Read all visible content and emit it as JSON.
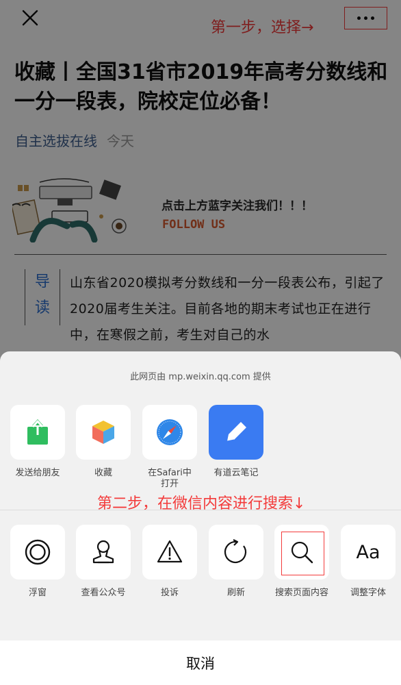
{
  "topbar": {
    "close_icon": "close-icon",
    "step1_annotation": "第一步，选择→",
    "more_icon": "more-dots-icon"
  },
  "article": {
    "title": "收藏丨全国31省市2019年高考分数线和一分一段表，院校定位必备！",
    "account_name": "自主选拔在线",
    "date": "今天",
    "banner_text": "点击上方蓝字关注我们！！！",
    "banner_follow": "FOLLOW US",
    "guide_label_1": "导",
    "guide_label_2": "读",
    "guide_text": "山东省2020模拟考分数线和一分一段表公布，引起了2020届考生关注。目前各地的期末考试也正在进行中，在寒假之前，考生对自己的水"
  },
  "sheet": {
    "provider": "此网页由 mp.weixin.qq.com 提供",
    "row1": [
      {
        "label": "发送给朋友",
        "icon": "share-upload-icon"
      },
      {
        "label": "收藏",
        "icon": "favorite-cube-icon"
      },
      {
        "label": "在Safari中\n打开",
        "icon": "safari-compass-icon"
      },
      {
        "label": "有道云笔记",
        "icon": "youdao-note-icon"
      }
    ],
    "step2_annotation": "第二步，在微信内容进行搜索↓",
    "row2": [
      {
        "label": "浮窗",
        "icon": "float-window-icon"
      },
      {
        "label": "查看公众号",
        "icon": "official-account-icon"
      },
      {
        "label": "投诉",
        "icon": "warning-icon"
      },
      {
        "label": "刷新",
        "icon": "refresh-icon"
      },
      {
        "label": "搜索页面内容",
        "icon": "search-icon"
      },
      {
        "label": "调整字体",
        "icon": "font-size-icon",
        "glyph": "Aa"
      }
    ],
    "cancel_label": "取消"
  },
  "colors": {
    "annotation_red": "#f33b3b",
    "account_blue": "#3e5f8f",
    "guide_blue": "#2d6fd1",
    "youdao_blue": "#3a7bf2",
    "share_green": "#2fbd5f",
    "follow_orange": "#d95a2e"
  }
}
